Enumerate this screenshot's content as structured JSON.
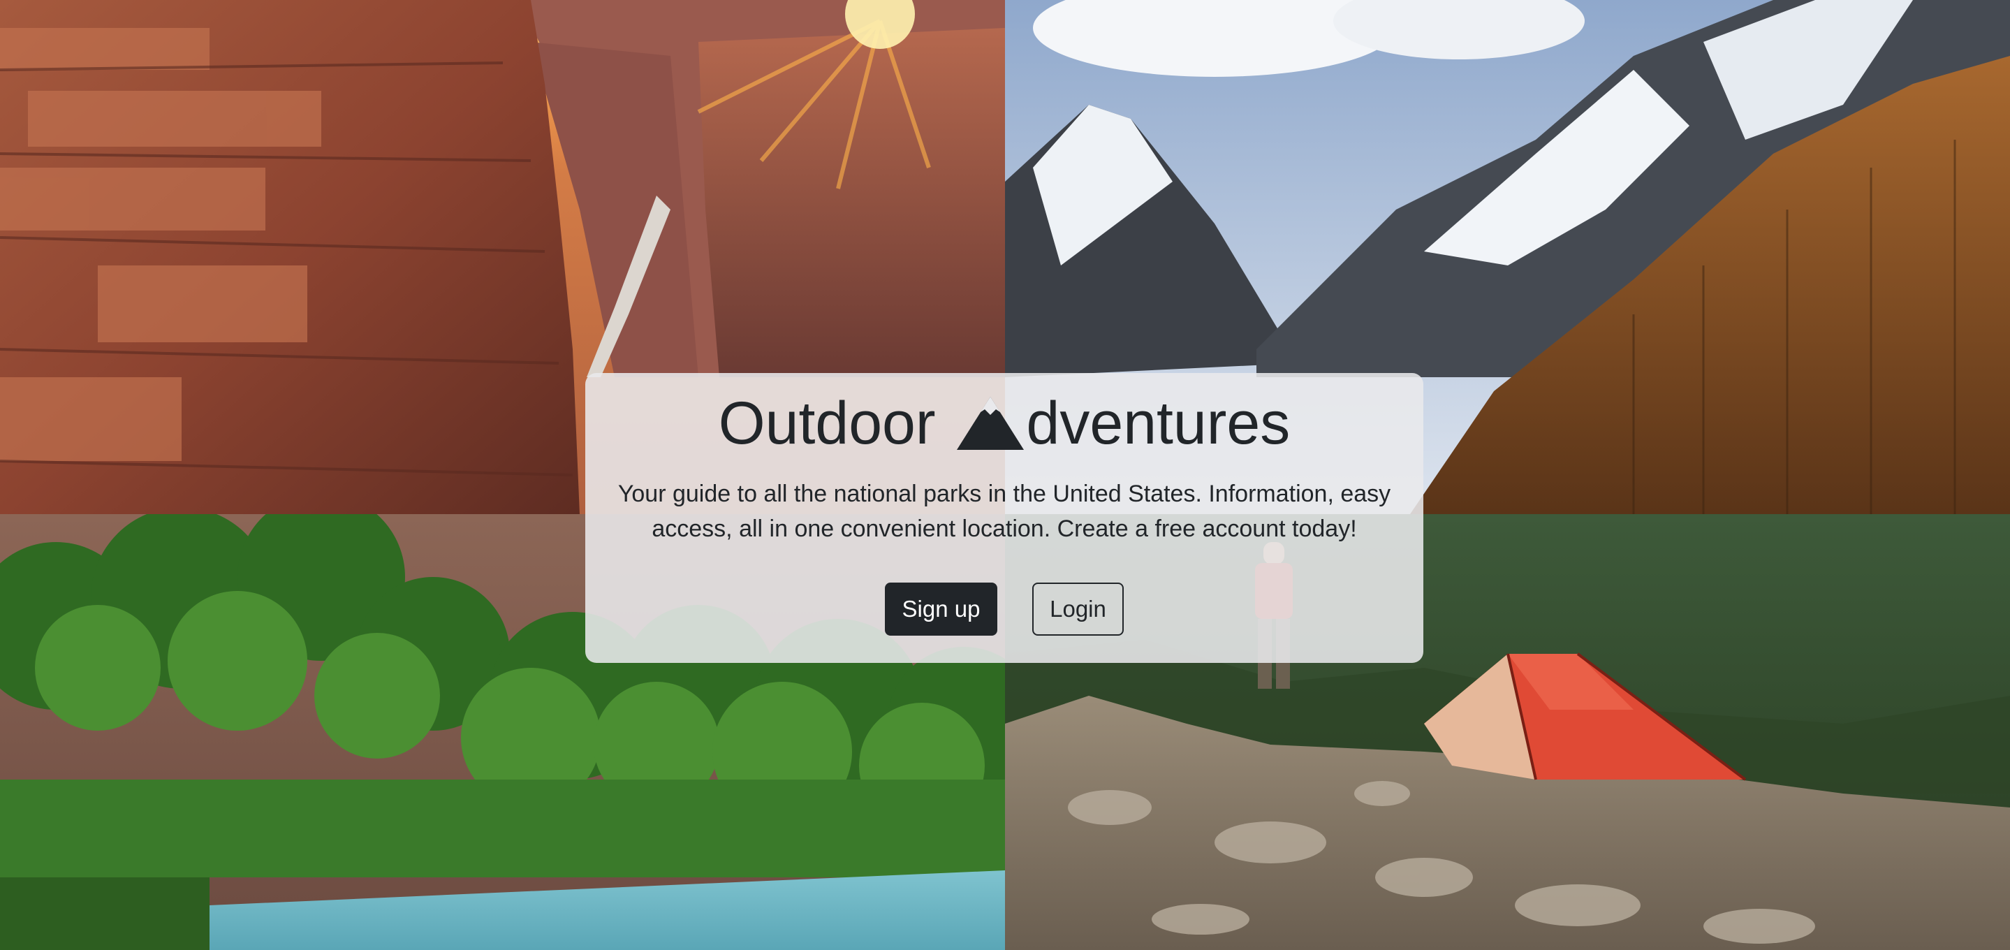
{
  "hero": {
    "title_before": "Outdoor",
    "title_after": "dventures",
    "logo_icon": "mountain-icon",
    "description": "Your guide to all the national parks in the United States. Information, easy access, all in one convenient location. Create a free account today!",
    "signup_label": "Sign up",
    "login_label": "Login"
  },
  "background": {
    "tiles": [
      "canyon-photo",
      "snowy-mountains-photo",
      "river-trees-photo",
      "camping-tent-photo"
    ]
  },
  "colors": {
    "text": "#212529",
    "button_dark": "#212529",
    "panel": "#e9e9ec"
  }
}
